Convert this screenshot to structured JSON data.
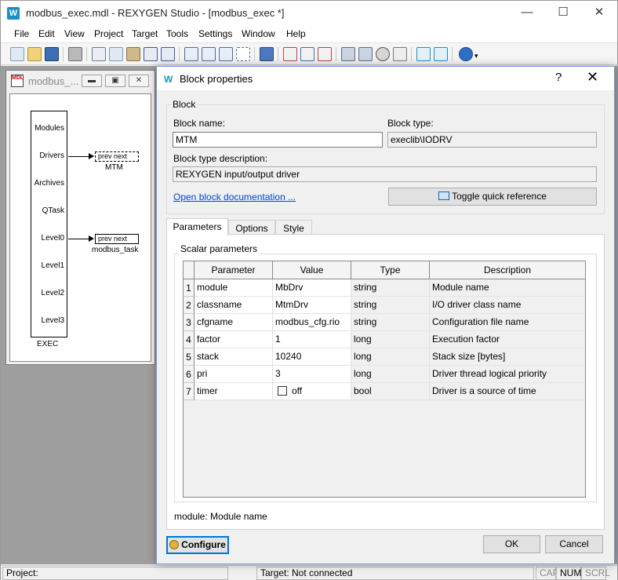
{
  "window": {
    "title": "modbus_exec.mdl - REXYGEN Studio - [modbus_exec *]",
    "minimize": "—",
    "maximize": "☐",
    "close": "✕"
  },
  "menu": [
    "File",
    "Edit",
    "View",
    "Project",
    "Target",
    "Tools",
    "Settings",
    "Window",
    "Help"
  ],
  "mdi": {
    "title": "modbus_...",
    "minimize": "▬",
    "restore": "▣",
    "close": "✕",
    "exec_block": {
      "name": "EXEC",
      "ports": [
        "Modules",
        "Drivers",
        "Archives",
        "QTask",
        "Level0",
        "Level1",
        "Level2",
        "Level3"
      ]
    },
    "mtm_block": {
      "label": "prev  next",
      "name": "MTM"
    },
    "task_block": {
      "label": "prev  next",
      "name": "modbus_task"
    }
  },
  "status": {
    "project": "Project:",
    "target": "Target: Not connected",
    "cap": "CAP",
    "num": "NUM",
    "scrl": "SCRL"
  },
  "dialog": {
    "title": "Block properties",
    "help": "?",
    "close": "✕",
    "block_group": "Block",
    "block_name_label": "Block name:",
    "block_name": "MTM",
    "block_type_label": "Block type:",
    "block_type": "execlib\\IODRV",
    "description_label": "Block type description:",
    "description": "REXYGEN input/output driver",
    "doc_link": "Open block documentation ...",
    "toggle_button": "Toggle quick reference",
    "tabs": [
      "Parameters",
      "Options",
      "Style"
    ],
    "scalar_group": "Scalar parameters",
    "columns": [
      "Parameter",
      "Value",
      "Type",
      "Description"
    ],
    "rows": [
      {
        "num": "1",
        "param": "module",
        "value": "MbDrv",
        "type": "string",
        "desc": "Module name"
      },
      {
        "num": "2",
        "param": "classname",
        "value": "MtmDrv",
        "type": "string",
        "desc": "I/O driver class name"
      },
      {
        "num": "3",
        "param": "cfgname",
        "value": "modbus_cfg.rio",
        "type": "string",
        "desc": "Configuration file name"
      },
      {
        "num": "4",
        "param": "factor",
        "value": "1",
        "type": "long",
        "desc": "Execution factor"
      },
      {
        "num": "5",
        "param": "stack",
        "value": "10240",
        "type": "long",
        "desc": "Stack size [bytes]"
      },
      {
        "num": "6",
        "param": "pri",
        "value": "3",
        "type": "long",
        "desc": "Driver thread logical priority"
      },
      {
        "num": "7",
        "param": "timer",
        "value": "off",
        "type": "bool",
        "desc": "Driver is a source of time"
      }
    ],
    "hint": "module: Module name",
    "configure_button": "Configure",
    "ok_button": "OK",
    "cancel_button": "Cancel"
  },
  "colors": {
    "accent": "#0078d7",
    "link": "#0046d5",
    "workspace": "#9e9e9e"
  }
}
